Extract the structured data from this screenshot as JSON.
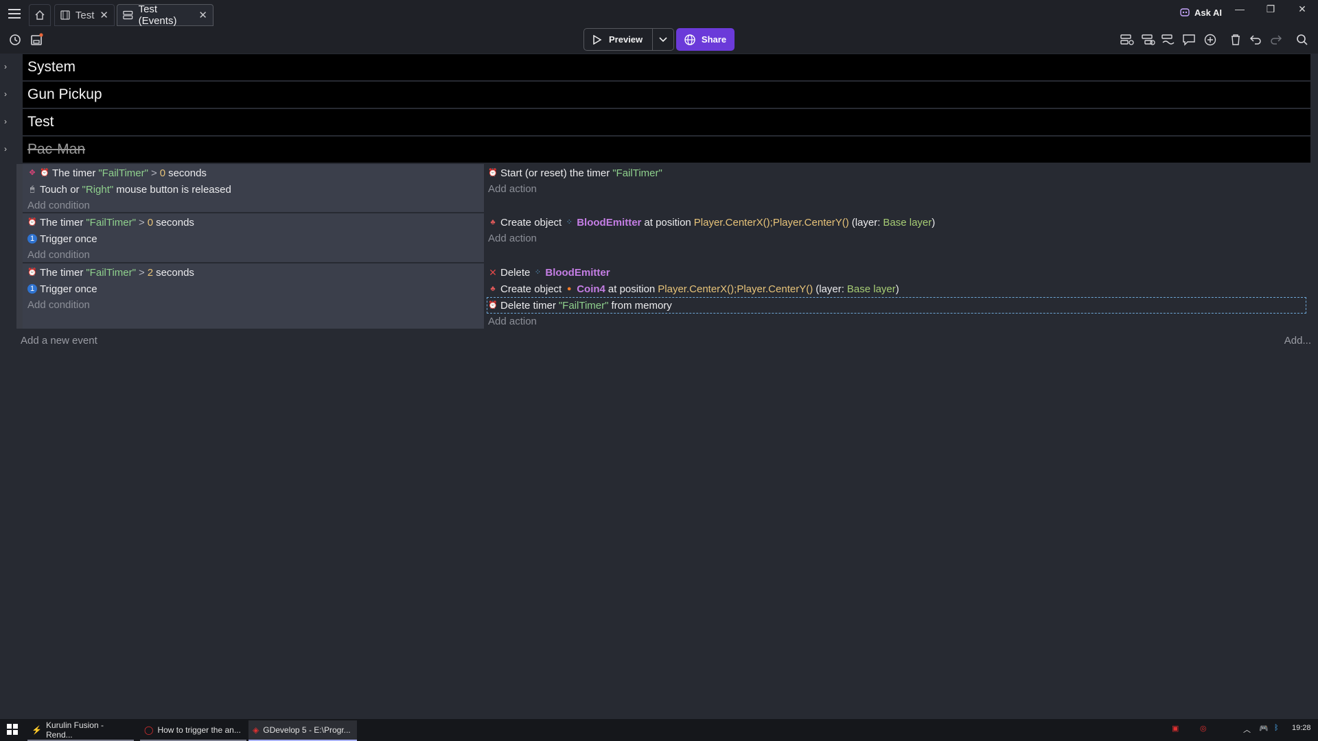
{
  "tabs": [
    {
      "label": "Test"
    },
    {
      "label": "Test (Events)"
    }
  ],
  "ask_ai": "Ask AI",
  "toolbar": {
    "preview": "Preview",
    "share": "Share"
  },
  "groups": [
    "System",
    "Gun Pickup",
    "Test",
    "Pac-Man"
  ],
  "events": [
    {
      "conditions": [
        {
          "text": "The timer",
          "string": "\"FailTimer\"",
          "op": ">",
          "num": "0",
          "suffix": "seconds"
        },
        {
          "text": "Touch or",
          "string": "\"Right\"",
          "suffix": "mouse button is released"
        }
      ],
      "add_condition": "Add condition",
      "actions": [
        {
          "text": "Start (or reset) the timer",
          "string": "\"FailTimer\""
        }
      ],
      "add_action": "Add action"
    },
    {
      "conditions": [
        {
          "text": "The timer",
          "string": "\"FailTimer\"",
          "op": ">",
          "num": "0",
          "suffix": "seconds"
        },
        {
          "text": "Trigger once"
        }
      ],
      "add_condition": "Add condition",
      "actions": [
        {
          "text": "Create object",
          "object": "BloodEmitter",
          "mid": "at position",
          "expr": "Player.CenterX();Player.CenterY()",
          "layer_pre": "(layer:",
          "layer": "Base layer",
          "layer_post": ")"
        }
      ],
      "add_action": "Add action"
    },
    {
      "conditions": [
        {
          "text": "The timer",
          "string": "\"FailTimer\"",
          "op": ">",
          "num": "2",
          "suffix": "seconds"
        },
        {
          "text": "Trigger once"
        }
      ],
      "add_condition": "Add condition",
      "actions": [
        {
          "text": "Delete",
          "object": "BloodEmitter"
        },
        {
          "text": "Create object",
          "object": "Coin4",
          "mid": "at position",
          "expr": "Player.CenterX();Player.CenterY()",
          "layer_pre": "(layer:",
          "layer": "Base layer",
          "layer_post": ")"
        },
        {
          "text": "Delete timer",
          "string": "\"FailTimer\"",
          "suffix": "from memory"
        }
      ],
      "add_action": "Add action"
    }
  ],
  "add_new_event": "Add a new event",
  "add_more": "Add...",
  "taskbar": {
    "items": [
      "Kurulin Fusion - Rend...",
      "How to trigger the an...",
      "GDevelop 5 - E:\\Progr..."
    ],
    "clock": "19:28"
  }
}
